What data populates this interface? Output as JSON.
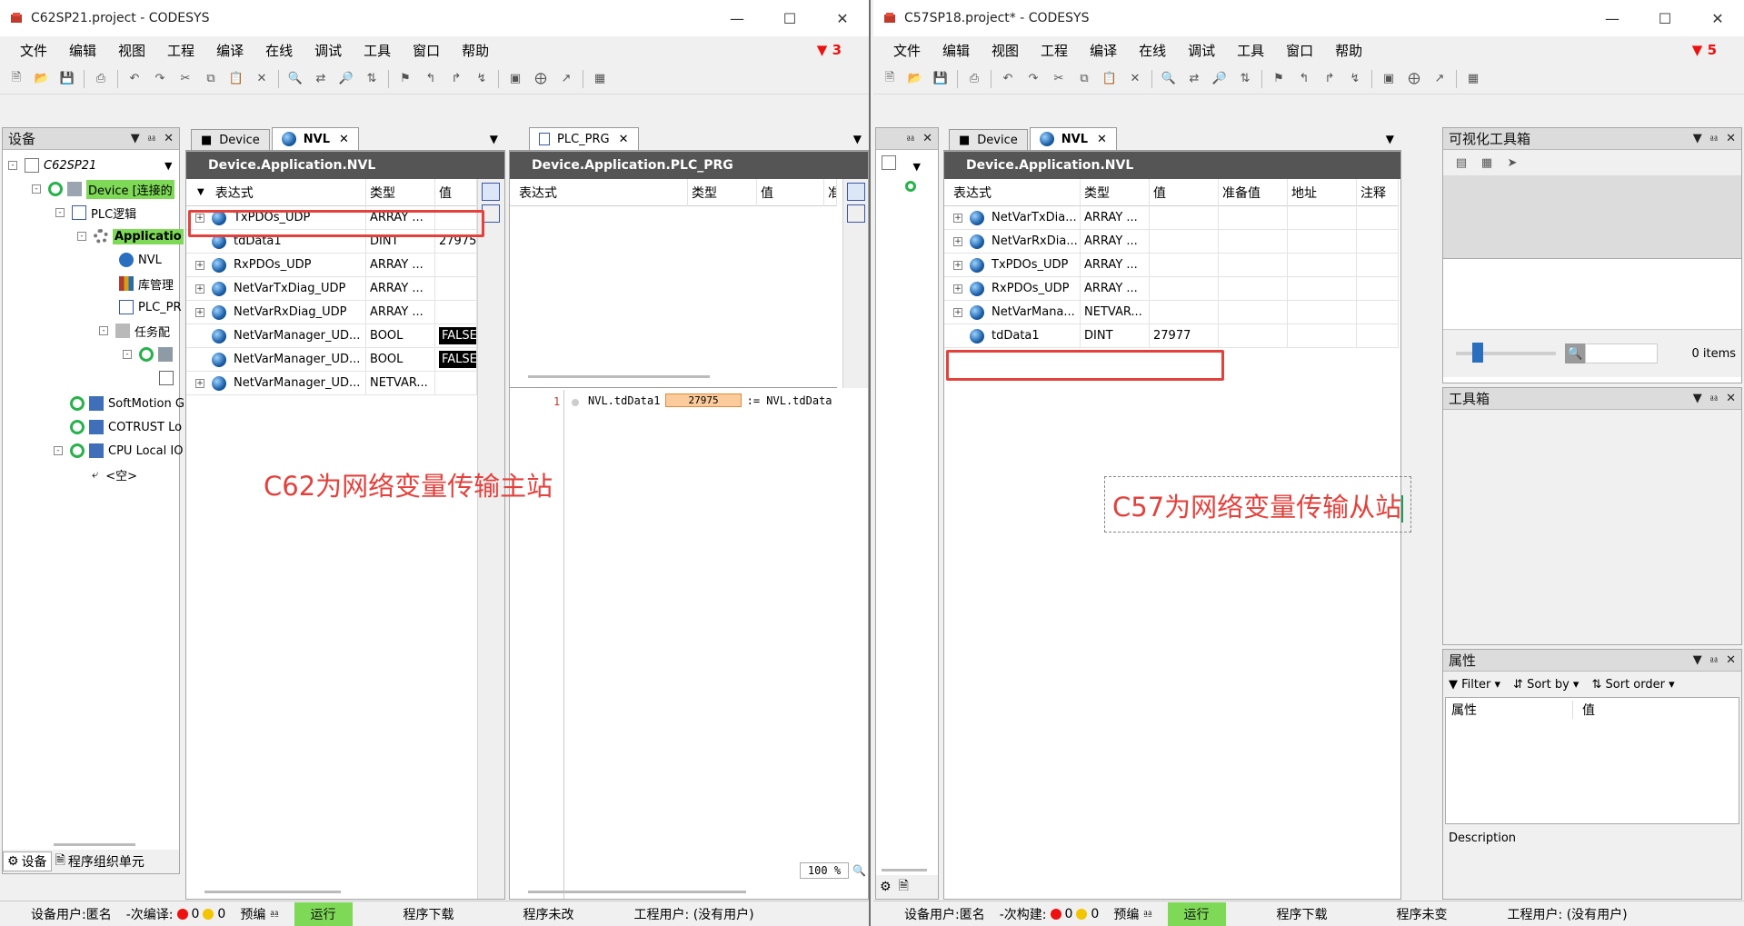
{
  "left": {
    "title": "C62SP21.project - CODESYS",
    "menu": [
      "文件",
      "编辑",
      "视图",
      "工程",
      "编译",
      "在线",
      "调试",
      "工具",
      "窗口",
      "帮助"
    ],
    "filter_count": "3",
    "devices_pane": {
      "title": "设备",
      "nodes": [
        "C62SP21",
        "Device [连接的",
        "PLC逻辑",
        "Applicatio",
        "NVL",
        "库管理",
        "PLC_PR",
        "任务配",
        "SoftMotion G",
        "COTRUST Lo",
        "CPU Local IO",
        "<空>"
      ],
      "bottom_tabs": [
        "设备",
        "程序组织单元"
      ]
    },
    "nvl_editor": {
      "tabs": [
        "Device",
        "NVL"
      ],
      "header": "Device.Application.NVL",
      "columns": [
        "表达式",
        "类型",
        "值"
      ],
      "rows": [
        {
          "expr": "TxPDOs_UDP",
          "type": "ARRAY ...",
          "value": ""
        },
        {
          "expr": "tdData1",
          "type": "DINT",
          "value": "27975"
        },
        {
          "expr": "RxPDOs_UDP",
          "type": "ARRAY ...",
          "value": ""
        },
        {
          "expr": "NetVarTxDiag_UDP",
          "type": "ARRAY ...",
          "value": ""
        },
        {
          "expr": "NetVarRxDiag_UDP",
          "type": "ARRAY ...",
          "value": ""
        },
        {
          "expr": "NetVarManager_UD...",
          "type": "BOOL",
          "value": "FALSE"
        },
        {
          "expr": "NetVarManager_UD...",
          "type": "BOOL",
          "value": "FALSE"
        },
        {
          "expr": "NetVarManager_UD...",
          "type": "NETVAR...",
          "value": ""
        }
      ]
    },
    "prg_editor": {
      "tab": "PLC_PRG",
      "header": "Device.Application.PLC_PRG",
      "columns": [
        "表达式",
        "类型",
        "值",
        "准"
      ],
      "line_no": "1",
      "code_left": "NVL.tdData1",
      "code_value": "27975",
      "code_right": ":= NVL.tdData",
      "zoom": "100 %"
    },
    "annotation": "C62为网络变量传输主站",
    "status": {
      "user": "设备用户:匿名",
      "compile": "-次编译:",
      "errors": "0",
      "warnings": "0",
      "precompile": "预编",
      "run": "运行",
      "download": "程序下载",
      "unchanged": "程序未改",
      "project_user": "工程用户: (没有用户)"
    }
  },
  "right": {
    "title": "C57SP18.project* - CODESYS",
    "menu": [
      "文件",
      "编辑",
      "视图",
      "工程",
      "编译",
      "在线",
      "调试",
      "工具",
      "窗口",
      "帮助"
    ],
    "filter_count": "5",
    "nvl_editor": {
      "tabs": [
        "Device",
        "NVL"
      ],
      "header": "Device.Application.NVL",
      "columns": [
        "表达式",
        "类型",
        "值",
        "准备值",
        "地址",
        "注释"
      ],
      "rows": [
        {
          "expr": "NetVarTxDia...",
          "type": "ARRAY ...",
          "value": ""
        },
        {
          "expr": "NetVarRxDia...",
          "type": "ARRAY ...",
          "value": ""
        },
        {
          "expr": "TxPDOs_UDP",
          "type": "ARRAY ...",
          "value": ""
        },
        {
          "expr": "RxPDOs_UDP",
          "type": "ARRAY ...",
          "value": ""
        },
        {
          "expr": "NetVarMana...",
          "type": "NETVAR...",
          "value": ""
        },
        {
          "expr": "tdData1",
          "type": "DINT",
          "value": "27977"
        }
      ]
    },
    "vis_toolbox": {
      "title": "可视化工具箱",
      "items_count": "0 items"
    },
    "toolbox": {
      "title": "工具箱"
    },
    "properties": {
      "title": "属性",
      "filter": "Filter",
      "sort_by": "Sort by",
      "sort_order": "Sort order",
      "col_prop": "属性",
      "col_val": "值",
      "description": "Description"
    },
    "annotation": "C57为网络变量传输从站",
    "status": {
      "user": "设备用户:匿名",
      "compile": "-次构建:",
      "errors": "0",
      "warnings": "0",
      "precompile": "预编",
      "run": "运行",
      "download": "程序下载",
      "unchanged": "程序未变",
      "project_user": "工程用户: (没有用户)"
    }
  }
}
